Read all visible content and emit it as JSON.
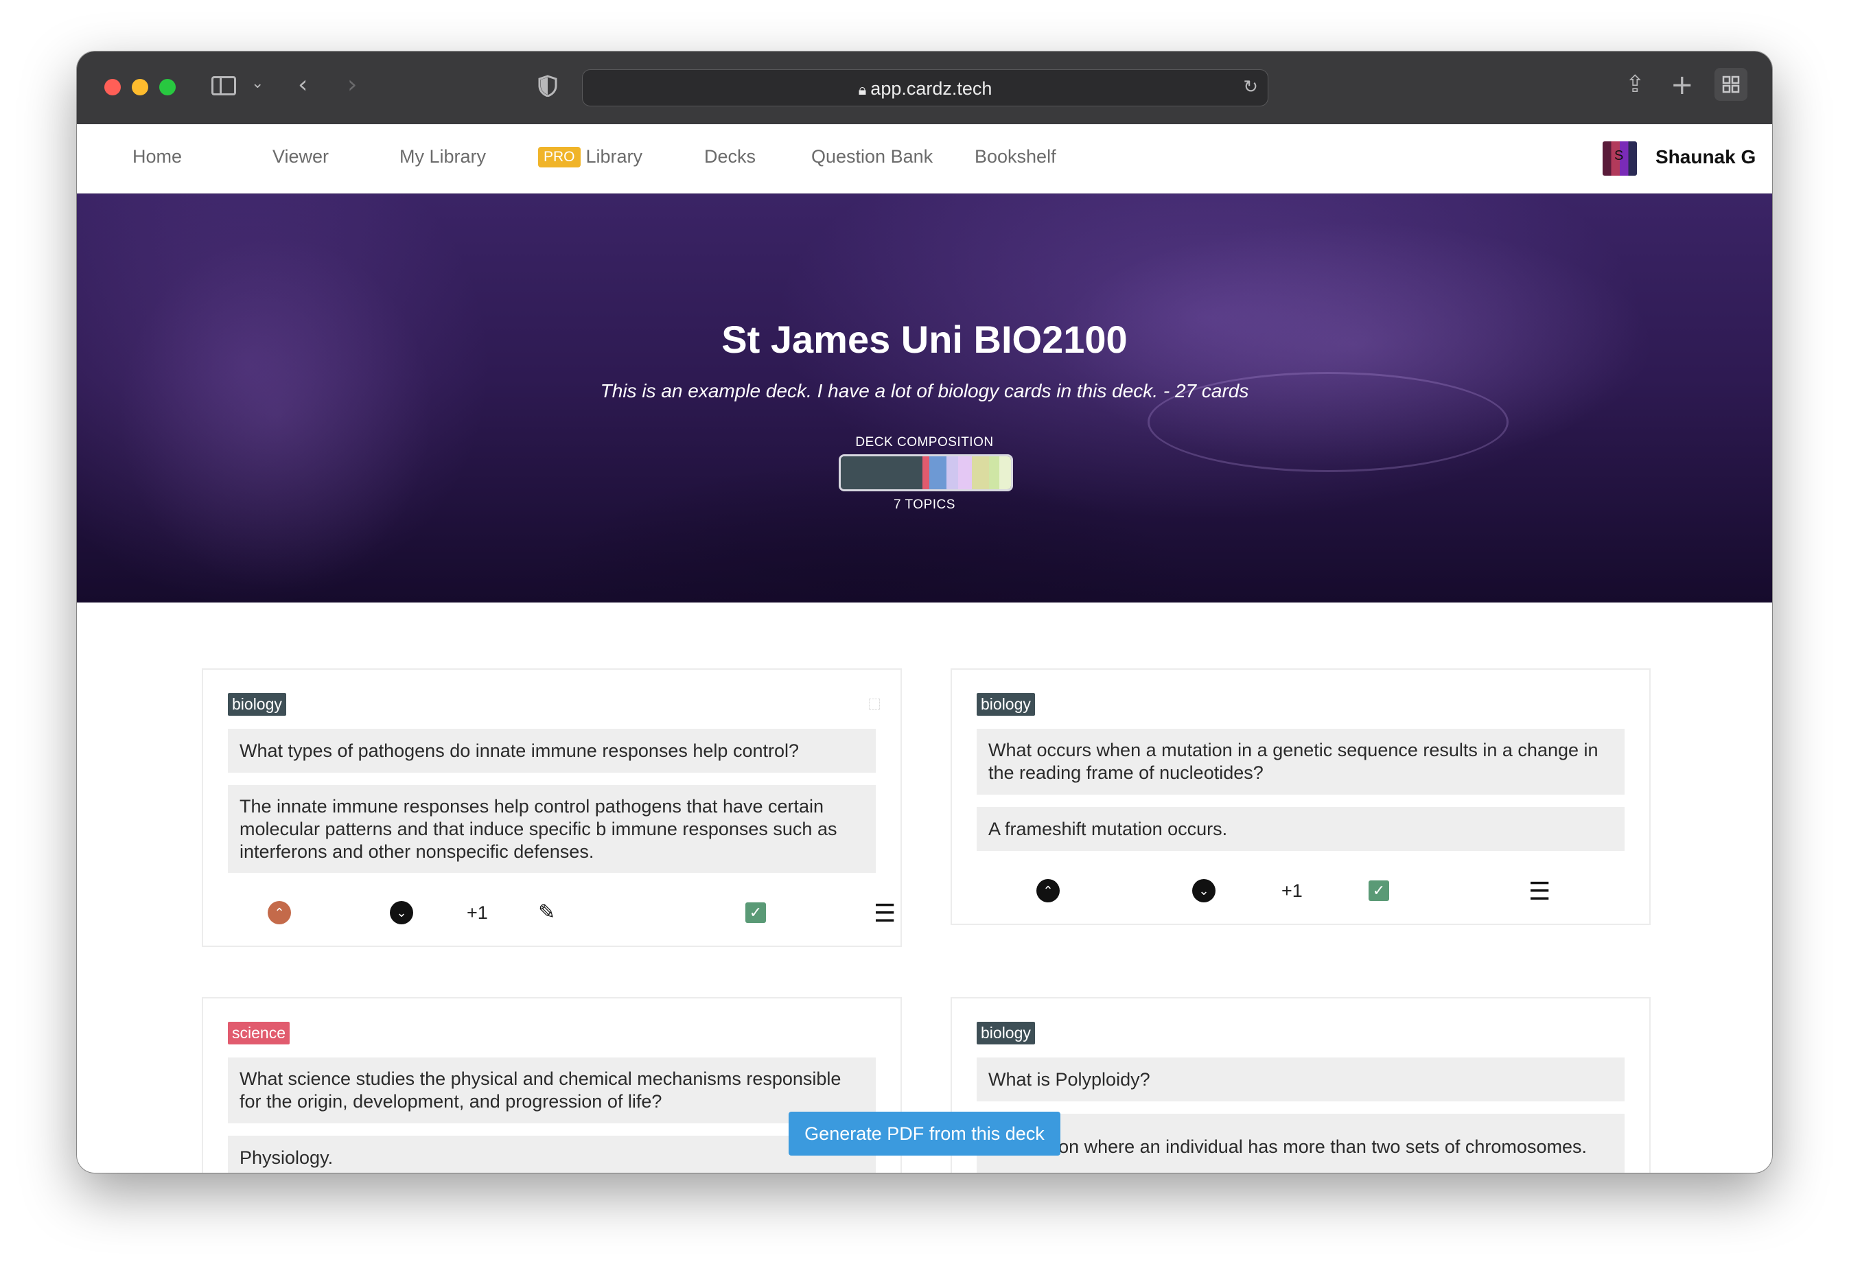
{
  "browser": {
    "url": "app.cardz.tech",
    "lock_icon": "lock-icon",
    "colors": {
      "close": "#ff5f57",
      "minimize": "#febc2e",
      "zoom": "#28c840"
    }
  },
  "nav": {
    "items": [
      {
        "label": "Home"
      },
      {
        "label": "Viewer"
      },
      {
        "label": "My Library"
      },
      {
        "badge": "PRO",
        "label": "Library"
      },
      {
        "label": "Decks"
      },
      {
        "label": "Question Bank"
      },
      {
        "label": "Bookshelf"
      }
    ],
    "user_avatar_initial": "S",
    "user_name": "Shaunak G"
  },
  "hero": {
    "title": "St James Uni BIO2100",
    "subtitle": "This is an example deck. I have a lot of biology cards in this deck. - 27 cards",
    "composition_label": "DECK COMPOSITION",
    "composition_colors": [
      "#3e4f56",
      "#e15b6e",
      "#6d99d4",
      "#cfc6f0",
      "#e4c8f4",
      "#dbdca0",
      "#cfe6a5",
      "#e9f2d0"
    ],
    "composition_fractions": [
      0.48,
      0.04,
      0.1,
      0.07,
      0.08,
      0.1,
      0.06,
      0.07
    ],
    "topics_label": "7 TOPICS"
  },
  "cards": [
    {
      "tag": "biology",
      "tag_color": "#3e4f56",
      "question": "What types of pathogens do innate immune responses help control?",
      "answer": "The innate immune responses help control pathogens that have certain molecular patterns and that induce specific b immune responses such as interferons and other nonspecific defenses.",
      "upvote_color": "#c46a4a",
      "votes": "+1"
    },
    {
      "tag": "biology",
      "tag_color": "#3e4f56",
      "question": "What occurs when a mutation in a genetic sequence results in a change in the reading frame of nucleotides?",
      "answer": "A frameshift mutation occurs.",
      "upvote_color": "#111111",
      "votes": "+1"
    },
    {
      "tag": "science",
      "tag_color": "#e15b6e",
      "question": "What science studies the physical and chemical mechanisms responsible for the origin, development, and progression of life?",
      "answer": "Physiology."
    },
    {
      "tag": "biology",
      "tag_color": "#3e4f56",
      "question": "What is Polyploidy?",
      "answer": "A condition where an individual has more than two sets of chromosomes."
    }
  ],
  "generate_pdf_label": "Generate PDF from this deck"
}
